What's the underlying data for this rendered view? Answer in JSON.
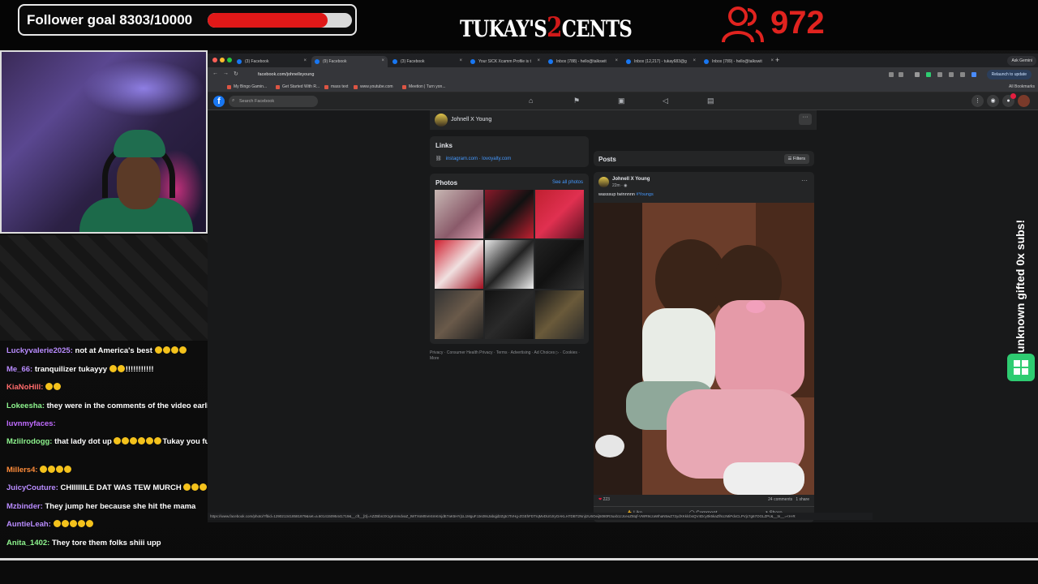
{
  "overlay": {
    "follower_goal": "Follower goal 8303/10000",
    "goal_progress": 0.83,
    "brand_pre": "TUKAY'S",
    "brand_num": "2",
    "brand_post": "CENTS",
    "viewer_count": "972",
    "accent": "#e0231f",
    "sub_text": "unknown gifted 0x subs!"
  },
  "chat": [
    {
      "user": "Luckyvalerie2025:",
      "color": "#b98cff",
      "msg": "not at America's best",
      "emoji": 4
    },
    {
      "user": "Me_66:",
      "color": "#b98cff",
      "msg": "tranquilizer tukayyy",
      "emoji": 2,
      "suffix": "!!!!!!!!!!!"
    },
    {
      "user": "KiaNoHill:",
      "color": "#ff6b6b",
      "msg": "",
      "emoji": 2
    },
    {
      "user": "Lokeesha:",
      "color": "#8ef58e",
      "msg": "they were in the comments of the video earlier",
      "emoji": 0
    },
    {
      "user": "luvnmyfaces:",
      "color": "#c06bff",
      "msg": "",
      "emoji": 0
    },
    {
      "user": "Mzlilrodogg:",
      "color": "#8ef58e",
      "msg": "that lady dot up",
      "emoji": 6,
      "suffix": "Tukay you funny"
    },
    {
      "user": "Millers4:",
      "color": "#ff8c3a",
      "msg": "",
      "emoji": 4
    },
    {
      "user": "JuicyCouture:",
      "color": "#b98cff",
      "msg": "CHIIIIIILE DAT WAS TEW MURCH",
      "emoji": 4
    },
    {
      "user": "Mzbinder:",
      "color": "#b98cff",
      "msg": "They jump her because she hit the mama",
      "emoji": 0
    },
    {
      "user": "AuntieLeah:",
      "color": "#b98cff",
      "msg": "",
      "emoji": 5
    },
    {
      "user": "Anita_1402:",
      "color": "#8ef58e",
      "msg": "They tore them folks shiii upp",
      "emoji": 0
    }
  ],
  "browser": {
    "tabs": [
      {
        "label": "(3) Facebook",
        "active": false
      },
      {
        "label": "(9) Facebook",
        "active": true
      },
      {
        "label": "(3) Facebook",
        "active": false
      },
      {
        "label": "Your SICK Xcamm Profile is t",
        "active": false
      },
      {
        "label": "Inbox (788) - hello@talkswit",
        "active": false
      },
      {
        "label": "Inbox (12,217) - tukay683@g",
        "active": false
      },
      {
        "label": "Inbox (789) - hello@talkswit",
        "active": false
      }
    ],
    "ask_gemini": "Ask Gemini",
    "url": "facebook.com/johnellxyoung",
    "relaunch": "Relaunch to update",
    "bookmarks": [
      "My Bingo Gamin...",
      "Get Started With R...",
      "mass text",
      "www.youtube.com",
      "Meetion | Turn yon..."
    ],
    "all_bookmarks": "All Bookmarks",
    "status_url": "https://www.facebook.com/photo/?fbid=1290213418581879&set=a.601415095441719&__cft__[0]=AZZBbn3X1gKmmdvaZ_tWTXsM5VeSmKmjdE7aK5HYj1L1MguFJJe28sJabqjd2Zgtc7tVHg-ZGEhFDTrqMvDU0JryOAKLH7DBT2NnjIzU6Oeij5080R3uxb1zJceoZ5tqf-VWR9czaWhaN5wZ72ydXKklcbsQV4Dcy0k5kaZlhUzMiPdxCLPVjc7g67OGLZPc&__tn__=<H-R"
  },
  "facebook": {
    "search_placeholder": "Search Facebook",
    "profile_name": "Johnell X Young",
    "links_title": "Links",
    "link_text": "instagram.com · lovoyalty.com",
    "photos_title": "Photos",
    "see_all": "See all photos",
    "footer": "Privacy · Consumer Health Privacy · Terms · Advertising · Ad Choices ▷ · Cookies · More",
    "posts_title": "Posts",
    "filters": "Filters",
    "post": {
      "author": "Johnell X Young",
      "time": "22m · ◉",
      "caption": "wasssup twinnnnn",
      "hashtag": "#Youngs",
      "reactions": "223",
      "comments": "24 comments",
      "shares": "1 share",
      "like": "Like",
      "comment": "Comment",
      "share": "Share"
    }
  }
}
